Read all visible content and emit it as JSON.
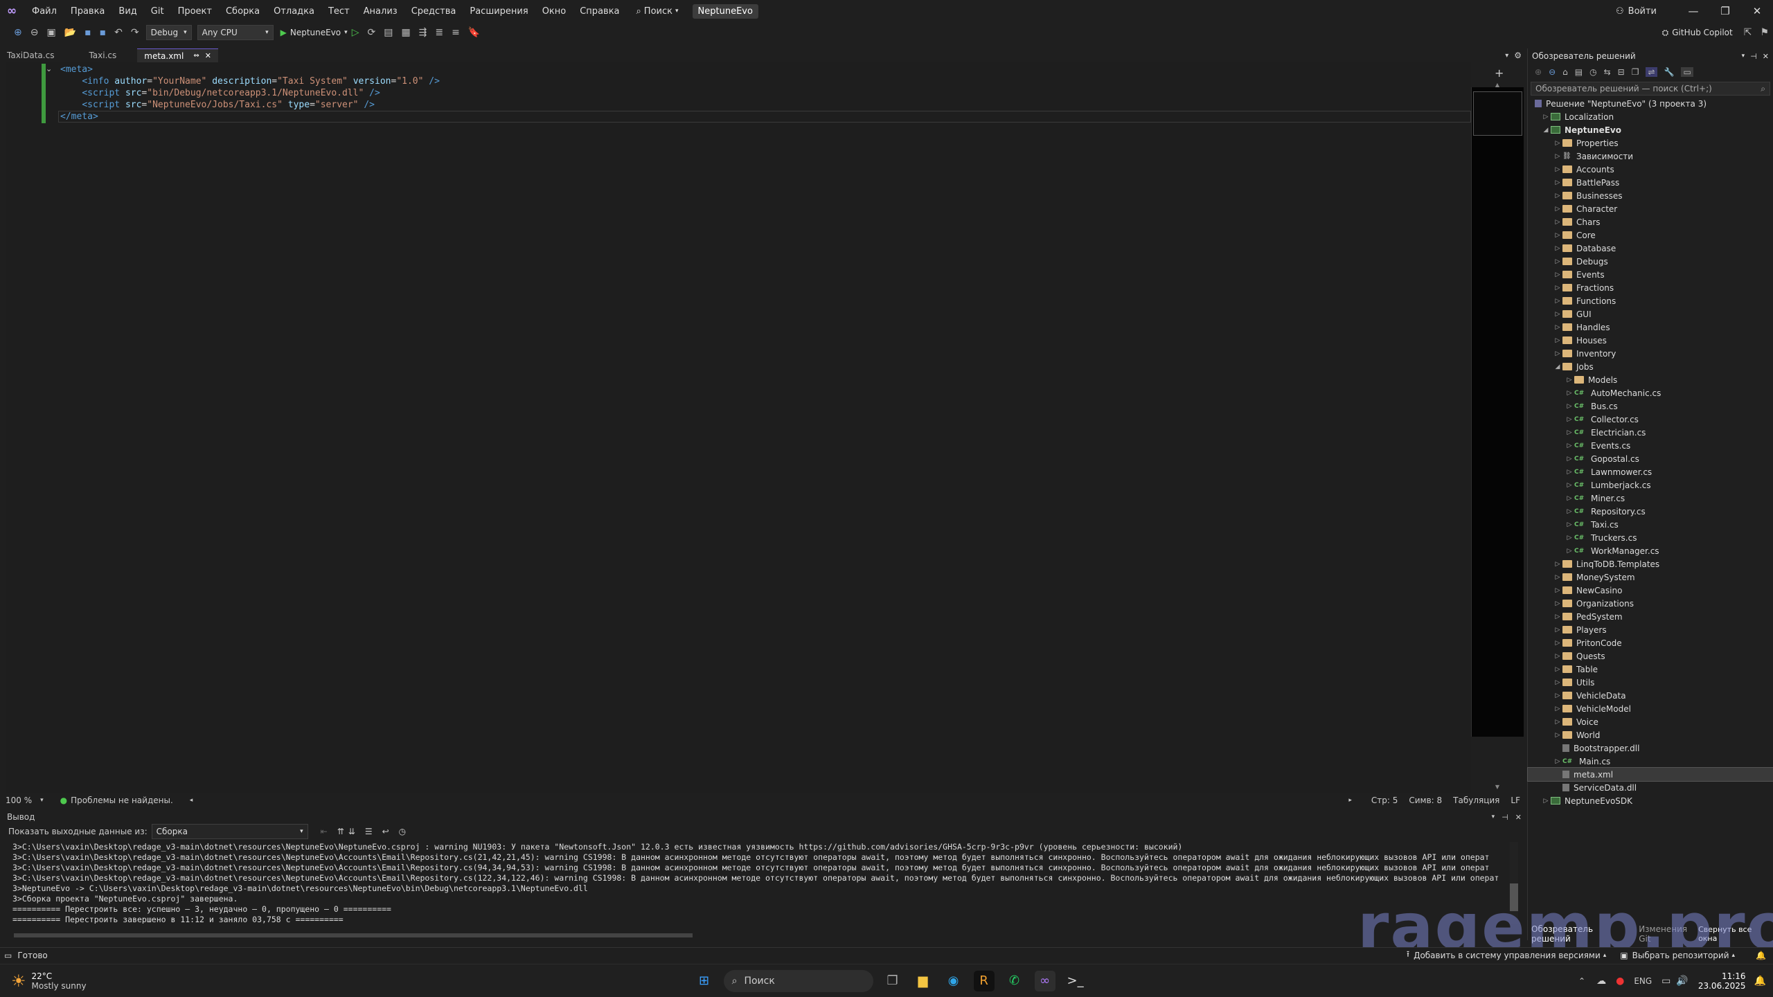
{
  "menu": {
    "items": [
      "Файл",
      "Правка",
      "Вид",
      "Git",
      "Проект",
      "Сборка",
      "Отладка",
      "Тест",
      "Анализ",
      "Средства",
      "Расширения",
      "Окно",
      "Справка"
    ],
    "search": "Поиск",
    "solution_badge": "NeptuneEvo",
    "signin": "Войти"
  },
  "toolbar": {
    "config": "Debug",
    "platform": "Any CPU",
    "run_target": "NeptuneEvo",
    "copilot": "GitHub Copilot"
  },
  "tabs": [
    {
      "label": "TaxiData.cs"
    },
    {
      "label": "Taxi.cs"
    },
    {
      "label": "meta.xml"
    }
  ],
  "editor": {
    "zoom": "100 %",
    "problems": "Проблемы не найдены.",
    "line": "Стр: 5",
    "col": "Симв: 8",
    "indent": "Табуляция",
    "eol": "LF"
  },
  "output": {
    "title": "Вывод",
    "show_from_label": "Показать выходные данные из:",
    "source": "Сборка",
    "lines": [
      "3>C:\\Users\\vaxin\\Desktop\\redage_v3-main\\dotnet\\resources\\NeptuneEvo\\NeptuneEvo.csproj : warning NU1903: У пакета \"Newtonsoft.Json\" 12.0.3 есть известная уязвимость https://github.com/advisories/GHSA-5crp-9r3c-p9vr (уровень серьезности: высокий)",
      "3>C:\\Users\\vaxin\\Desktop\\redage_v3-main\\dotnet\\resources\\NeptuneEvo\\Accounts\\Email\\Repository.cs(21,42,21,45): warning CS1998: В данном асинхронном методе отсутствуют операторы await, поэтому метод будет выполняться синхронно. Воспользуйтесь оператором await для ожидания неблокирующих вызовов API или операт",
      "3>C:\\Users\\vaxin\\Desktop\\redage_v3-main\\dotnet\\resources\\NeptuneEvo\\Accounts\\Email\\Repository.cs(94,34,94,53): warning CS1998: В данном асинхронном методе отсутствуют операторы await, поэтому метод будет выполняться синхронно. Воспользуйтесь оператором await для ожидания неблокирующих вызовов API или операт",
      "3>C:\\Users\\vaxin\\Desktop\\redage_v3-main\\dotnet\\resources\\NeptuneEvo\\Accounts\\Email\\Repository.cs(122,34,122,46): warning CS1998: В данном асинхронном методе отсутствуют операторы await, поэтому метод будет выполняться синхронно. Воспользуйтесь оператором await для ожидания неблокирующих вызовов API или операт",
      "3>NeptuneEvo -> C:\\Users\\vaxin\\Desktop\\redage_v3-main\\dotnet\\resources\\NeptuneEvo\\bin\\Debug\\netcoreapp3.1\\NeptuneEvo.dll",
      "3>Сборка проекта \"NeptuneEvo.csproj\" завершена.",
      "========== Перестроить все: успешно — 3, неудачно — 0, пропущено — 0 ==========",
      "========== Перестроить завершено в 11:12 и заняло 03,758 с =========="
    ]
  },
  "solution_explorer": {
    "title": "Обозреватель решений",
    "search_placeholder": "Обозреватель решений — поиск (Ctrl+;)",
    "solution": "Решение \"NeptuneEvo\" (3 проекта 3)",
    "items": [
      {
        "label": "Localization",
        "type": "proj"
      },
      {
        "label": "NeptuneEvo",
        "type": "proj"
      },
      {
        "label": "Properties",
        "type": "props"
      },
      {
        "label": "Зависимости",
        "type": "deps"
      },
      {
        "label": "Accounts",
        "type": "folder"
      },
      {
        "label": "BattlePass",
        "type": "folder"
      },
      {
        "label": "Businesses",
        "type": "folder"
      },
      {
        "label": "Character",
        "type": "folder"
      },
      {
        "label": "Chars",
        "type": "folder"
      },
      {
        "label": "Core",
        "type": "folder"
      },
      {
        "label": "Database",
        "type": "folder"
      },
      {
        "label": "Debugs",
        "type": "folder"
      },
      {
        "label": "Events",
        "type": "folder"
      },
      {
        "label": "Fractions",
        "type": "folder"
      },
      {
        "label": "Functions",
        "type": "folder"
      },
      {
        "label": "GUI",
        "type": "folder"
      },
      {
        "label": "Handles",
        "type": "folder"
      },
      {
        "label": "Houses",
        "type": "folder"
      },
      {
        "label": "Inventory",
        "type": "folder"
      },
      {
        "label": "Jobs",
        "type": "folder"
      },
      {
        "label": "Models",
        "type": "folder"
      },
      {
        "label": "AutoMechanic.cs",
        "type": "cs"
      },
      {
        "label": "Bus.cs",
        "type": "cs"
      },
      {
        "label": "Collector.cs",
        "type": "cs"
      },
      {
        "label": "Electrician.cs",
        "type": "cs"
      },
      {
        "label": "Events.cs",
        "type": "cs"
      },
      {
        "label": "Gopostal.cs",
        "type": "cs"
      },
      {
        "label": "Lawnmower.cs",
        "type": "cs"
      },
      {
        "label": "Lumberjack.cs",
        "type": "cs"
      },
      {
        "label": "Miner.cs",
        "type": "cs"
      },
      {
        "label": "Repository.cs",
        "type": "cs"
      },
      {
        "label": "Taxi.cs",
        "type": "cs"
      },
      {
        "label": "Truckers.cs",
        "type": "cs"
      },
      {
        "label": "WorkManager.cs",
        "type": "cs"
      },
      {
        "label": "LinqToDB.Templates",
        "type": "folder"
      },
      {
        "label": "MoneySystem",
        "type": "folder"
      },
      {
        "label": "NewCasino",
        "type": "folder"
      },
      {
        "label": "Organizations",
        "type": "folder"
      },
      {
        "label": "PedSystem",
        "type": "folder"
      },
      {
        "label": "Players",
        "type": "folder"
      },
      {
        "label": "PritonCode",
        "type": "folder"
      },
      {
        "label": "Quests",
        "type": "folder"
      },
      {
        "label": "Table",
        "type": "folder"
      },
      {
        "label": "Utils",
        "type": "folder"
      },
      {
        "label": "VehicleData",
        "type": "folder"
      },
      {
        "label": "VehicleModel",
        "type": "folder"
      },
      {
        "label": "Voice",
        "type": "folder"
      },
      {
        "label": "World",
        "type": "folder"
      },
      {
        "label": "Bootstrapper.dll",
        "type": "file"
      },
      {
        "label": "Main.cs",
        "type": "cs"
      },
      {
        "label": "meta.xml",
        "type": "file"
      },
      {
        "label": "ServiceData.dll",
        "type": "file"
      },
      {
        "label": "NeptuneEvoSDK",
        "type": "proj"
      }
    ],
    "bottom_tab_1": "Обозреватель решений",
    "bottom_tab_2": "Изменения Git",
    "collapse_all": "Свернуть все окна"
  },
  "statusbar": {
    "ready": "Готово",
    "add_to_vcs": "Добавить в систему управления версиями",
    "select_repo": "Выбрать репозиторий"
  },
  "taskbar": {
    "temp": "22°C",
    "weather": "Mostly sunny",
    "search": "Поиск",
    "lang": "ENG",
    "time": "11:16",
    "date": "23.06.2025"
  },
  "watermark": "ragemp.pro",
  "colors": {
    "accent": "#6a5acd",
    "folder": "#dcb67a",
    "cs": "#6abf69",
    "xml_tag": "#569cd6",
    "xml_attr": "#9cdcfe",
    "xml_value": "#ce9178"
  }
}
